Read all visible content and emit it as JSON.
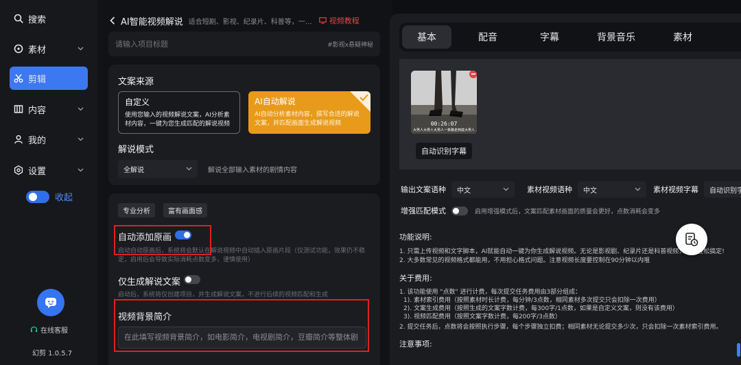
{
  "sidebar": {
    "items": [
      {
        "label": "搜索",
        "icon": "search-icon",
        "has_chevron": false,
        "active": false
      },
      {
        "label": "素材",
        "icon": "material-icon",
        "has_chevron": true,
        "active": false
      },
      {
        "label": "剪辑",
        "icon": "scissors-icon",
        "has_chevron": false,
        "active": true
      },
      {
        "label": "内容",
        "icon": "content-icon",
        "has_chevron": true,
        "active": false
      },
      {
        "label": "我的",
        "icon": "user-icon",
        "has_chevron": true,
        "active": false
      },
      {
        "label": "设置",
        "icon": "gear-icon",
        "has_chevron": true,
        "active": false
      }
    ],
    "collapse_label": "收起",
    "customer_service": "在线客服",
    "version": "幻剪 1.0.5.7"
  },
  "editor": {
    "title": "AI智能视频解说",
    "description": "适合短剧、影视、纪录片、科普等，一键自动生成解说视频",
    "tutorial_label": "视频教程",
    "title_placeholder": "请输入项目标题",
    "title_tag": "#影视x悬疑神秘"
  },
  "source": {
    "label": "文案来源",
    "custom": {
      "title": "自定义",
      "desc": "使用您输入的视频解说文案，AI分析素材内容，一键为您生成匹配的解说视频"
    },
    "ai": {
      "title": "AI自动解说",
      "desc": "AI自动分析素材内容，撰写合适的解说文案，并匹配画面生成解说视频"
    },
    "mode_label": "解说模式",
    "mode_value": "全解说",
    "mode_desc": "解说全部输入素材的剧情内容"
  },
  "advanced": {
    "chips": [
      "专业分析",
      "富有画面感"
    ],
    "auto_original": {
      "title": "自动添加原画",
      "enabled": true,
      "desc": "启动自动原画后，系统将会默认在解说视频中自动插入原画片段（仅测试功能，效果仍不稳定，启用后会导致实际消耗点数变多，谨慎使用）"
    },
    "script_only": {
      "title": "仅生成解说文案",
      "enabled": false,
      "desc": "启动后，系统将仅创建项目，并生成解说文案，不进行后续的视频匹配和生成"
    },
    "background": {
      "title": "视频背景简介",
      "placeholder": "在此填写视频背景简介，如电影简介，电视剧简介，豆瓣简介等整体剧情"
    }
  },
  "tabs": [
    "基本",
    "配音",
    "字幕",
    "背景音乐",
    "素材"
  ],
  "media": {
    "duration": "00:26:07",
    "subtitle_text": "大男人大男人大男人一条路走到底大男人",
    "auto_subtitle_button": "自动识别字幕"
  },
  "options": {
    "output_lang_label": "输出文案语种",
    "output_lang_value": "中文",
    "material_lang_label": "素材视频语种",
    "material_lang_value": "中文",
    "material_sub_label": "素材视频字幕",
    "material_sub_value": "自动识别字幕",
    "enhance_label": "增强匹配模式",
    "enhance_enabled": false,
    "enhance_desc": "启用增强模式后，文案匹配素材画面的质量会更好，点数消耗会变多"
  },
  "info": {
    "func_title": "功能说明:",
    "func_lines": [
      "1. 只需上传视频和文字脚本，AI就能自动一键为你生成解说视频。无论是影视剧、纪录片还是科普视频，都能轻松搞定!",
      "2. 大多数常见的视频格式都能用，不用担心格式问题。注意视频长度要控制在90分钟以内哦"
    ],
    "fee_title": "关于费用:",
    "fee_lines": [
      "1. 该功能使用 \"点数\" 进行计费，每次提交任务费用由3部分组成：",
      "   1). 素材索引费用（按照素材时长计费，每分钟/3点数，相同素材多次提交只会扣除一次费用）",
      "   2). 文案生成费用（按照生成的文案字数计费，每300字/1点数，如果是自定义文案，则没有该费用）",
      "   3). 视频匹配费用（按照文案字数计费，每200字/3点数）",
      "2. 提交任务后，点数将会按照执行步骤，每个步骤独立扣费；相同素材无论提交多少次，只会扣除一次素材索引费用。"
    ],
    "notes_title": "注意事项:"
  },
  "colors": {
    "accent": "#3c78f0",
    "ai_card": "#e89a1a",
    "highlight_box": "#e02020"
  }
}
